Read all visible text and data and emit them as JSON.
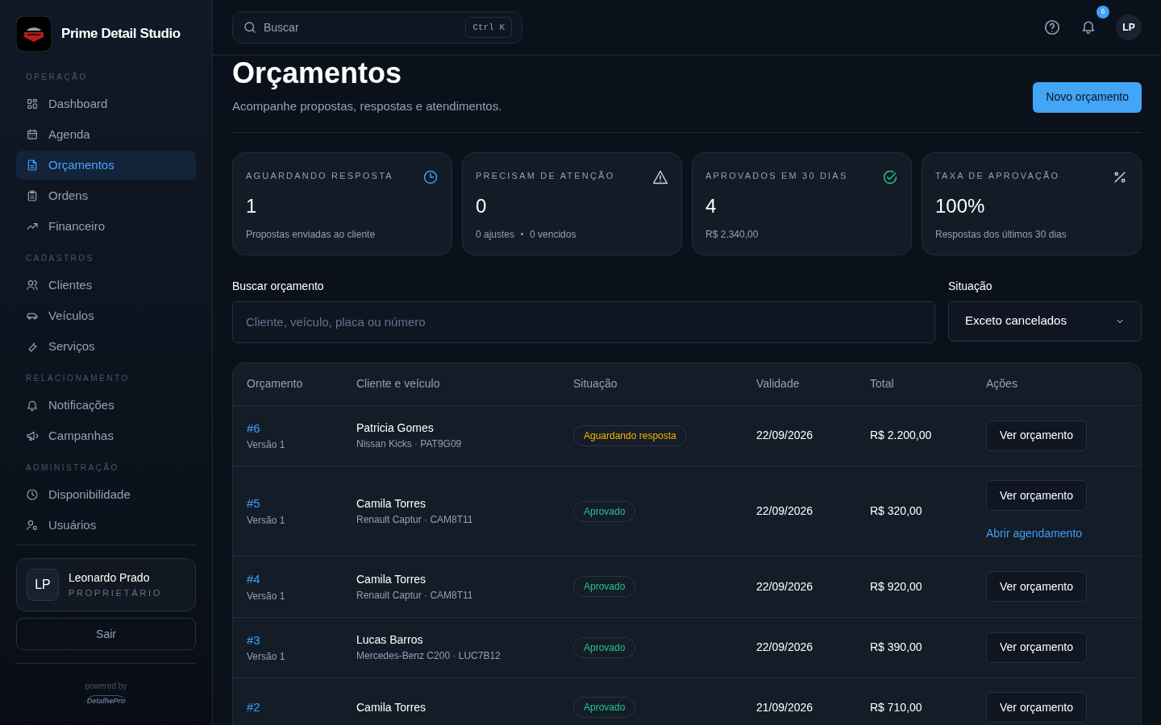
{
  "brand": {
    "name": "Prime Detail Studio"
  },
  "sidebar": {
    "sections": [
      {
        "title": "OPERAÇÃO",
        "items": [
          {
            "label": "Dashboard",
            "selected": false
          },
          {
            "label": "Agenda",
            "selected": false
          },
          {
            "label": "Orçamentos",
            "selected": true
          },
          {
            "label": "Ordens",
            "selected": false
          },
          {
            "label": "Financeiro",
            "selected": false
          }
        ]
      },
      {
        "title": "CADASTROS",
        "items": [
          {
            "label": "Clientes",
            "selected": false
          },
          {
            "label": "Veículos",
            "selected": false
          },
          {
            "label": "Serviços",
            "selected": false
          }
        ]
      },
      {
        "title": "RELACIONAMENTO",
        "items": [
          {
            "label": "Notificações",
            "selected": false
          },
          {
            "label": "Campanhas",
            "selected": false
          }
        ]
      },
      {
        "title": "ADMINISTRAÇÃO",
        "items": [
          {
            "label": "Disponibilidade",
            "selected": false
          },
          {
            "label": "Usuários",
            "selected": false
          }
        ]
      }
    ],
    "user": {
      "initials": "LP",
      "name": "Leonardo Prado",
      "role": "PROPRIETÁRIO"
    },
    "logout": "Sair",
    "powered_by": "powered by",
    "powered_logo": "DetalhePro"
  },
  "topbar": {
    "search_placeholder": "Buscar",
    "shortcut": "Ctrl K",
    "notification_count": "6",
    "avatar": "LP"
  },
  "page": {
    "title": "Orçamentos",
    "subtitle": "Acompanhe propostas, respostas e atendimentos.",
    "primary_button": "Novo orçamento"
  },
  "stats": [
    {
      "kind": "clock",
      "label": "AGUARDANDO RESPOSTA",
      "value": "1",
      "note": "Propostas enviadas ao cliente"
    },
    {
      "kind": "warning",
      "label": "PRECISAM DE ATENÇÃO",
      "value": "0",
      "note": "0 ajustes",
      "note_2": "0 vencidos"
    },
    {
      "kind": "check",
      "label": "APROVADOS EM 30 DIAS",
      "value": "4",
      "note": "R$ 2.340,00"
    },
    {
      "kind": "percent",
      "label": "TAXA DE APROVAÇÃO",
      "value": "100%",
      "note": "Respostas dos últimos 30 dias"
    }
  ],
  "filters": {
    "search_label": "Buscar orçamento",
    "search_placeholder": "Cliente, veículo, placa ou número",
    "status_label": "Situação",
    "status_value": "Exceto cancelados"
  },
  "table": {
    "columns": [
      "Orçamento",
      "Cliente e veículo",
      "Situação",
      "Validade",
      "Total",
      "Ações"
    ],
    "rows": [
      {
        "number": "#6",
        "version": "Versão 1",
        "client": "Patricia Gomes",
        "vehicle": "Nissan Kicks · PAT9G09",
        "status": "Aguardando resposta",
        "color": "#f5b400",
        "validity": "22/09/2026",
        "total": "R$ 2.200,00",
        "actions": [
          "Ver orçamento"
        ]
      },
      {
        "number": "#5",
        "version": "Versão 1",
        "client": "Camila Torres",
        "vehicle": "Renault Captur · CAM8T11",
        "status": "Aprovado",
        "color": "#22c58b",
        "validity": "22/09/2026",
        "total": "R$ 320,00",
        "actions": [
          "Ver orçamento"
        ],
        "link": "Abrir agendamento"
      },
      {
        "number": "#4",
        "version": "Versão 1",
        "client": "Camila Torres",
        "vehicle": "Renault Captur · CAM8T11",
        "status": "Aprovado",
        "color": "#22c58b",
        "validity": "22/09/2026",
        "total": "R$ 920,00",
        "actions": [
          "Ver orçamento"
        ]
      },
      {
        "number": "#3",
        "version": "Versão 1",
        "client": "Lucas Barros",
        "vehicle": "Mercedes-Benz C200 · LUC7B12",
        "status": "Aprovado",
        "color": "#22c58b",
        "validity": "22/09/2026",
        "total": "R$ 390,00",
        "actions": [
          "Ver orçamento"
        ]
      },
      {
        "number": "#2",
        "client": "Camila Torres",
        "status": "Aprovado",
        "color": "#22c58b",
        "validity": "21/09/2026",
        "total": "R$ 710,00",
        "actions": [
          "Ver orçamento"
        ]
      }
    ]
  }
}
